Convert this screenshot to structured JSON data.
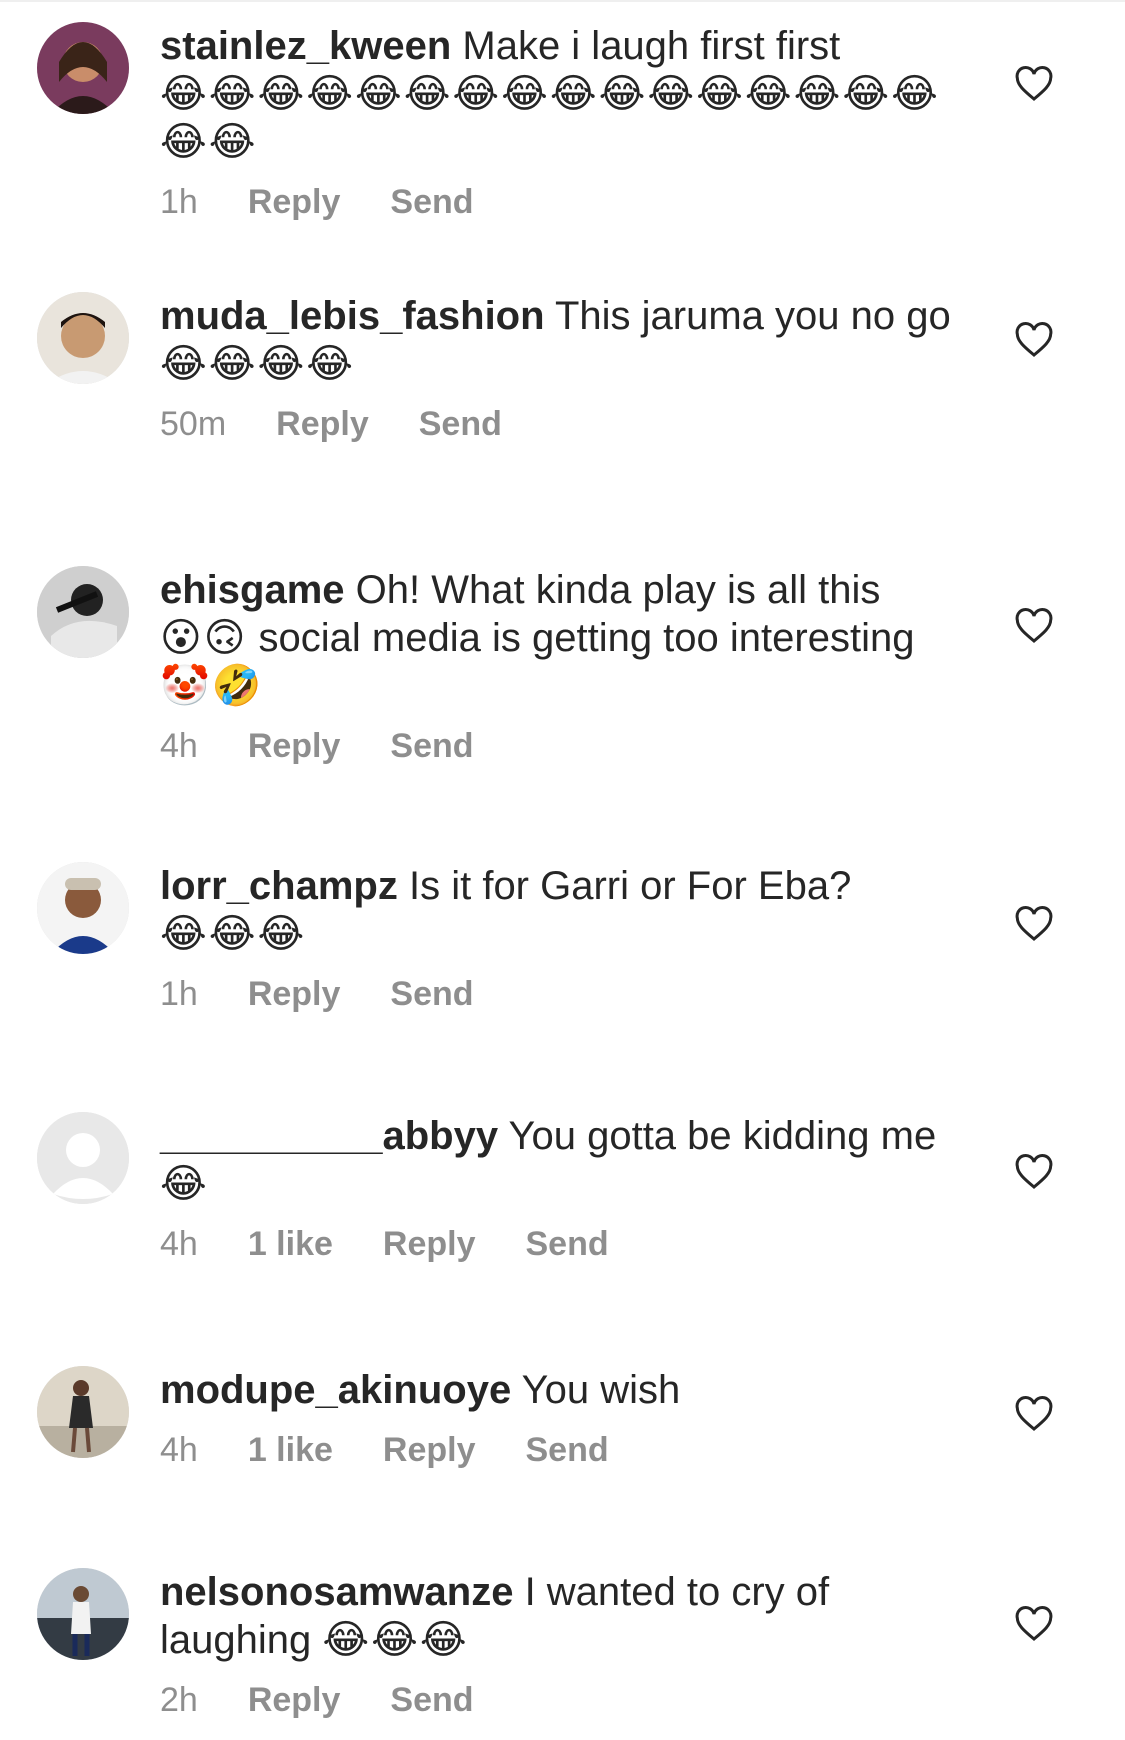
{
  "comments": [
    {
      "username": "stainlez_kween",
      "text": "Make i laugh first first",
      "emoji": "😂😂😂😂😂😂😂😂😂😂😂😂😂😂😂😂😂😂",
      "time": "1h",
      "likes": "",
      "reply": "Reply",
      "send": "Send"
    },
    {
      "username": "muda_lebis_fashion",
      "text": "This jaruma you no go",
      "emoji": "😂😂😂😂",
      "time": "50m",
      "likes": "",
      "reply": "Reply",
      "send": "Send"
    },
    {
      "username": "ehisgame",
      "text": "Oh! What kinda play is all this",
      "emoji": "😮🙃",
      "text2": "social media is getting too interesting",
      "emoji2": "🤡🤣",
      "time": "4h",
      "likes": "",
      "reply": "Reply",
      "send": "Send"
    },
    {
      "username": "lorr_champz",
      "text": "Is it for Garri or For Eba?",
      "emoji": "😂😂😂",
      "time": "1h",
      "likes": "",
      "reply": "Reply",
      "send": "Send"
    },
    {
      "username": "__________abbyy",
      "text": "You gotta be kidding me",
      "emoji": "😂",
      "time": "4h",
      "likes": "1 like",
      "reply": "Reply",
      "send": "Send"
    },
    {
      "username": "modupe_akinuoye",
      "text": "You wish",
      "emoji": "",
      "time": "4h",
      "likes": "1 like",
      "reply": "Reply",
      "send": "Send"
    },
    {
      "username": "nelsonosamwanze",
      "text": "I wanted to cry of laughing",
      "emoji": "😂😂😂",
      "time": "2h",
      "likes": "",
      "reply": "Reply",
      "send": "Send"
    }
  ],
  "icons": {
    "like": "heart-outline-icon",
    "avatar_placeholder": "default-avatar-icon"
  },
  "colors": {
    "meta": "#8e8e8e",
    "text": "#262626"
  }
}
